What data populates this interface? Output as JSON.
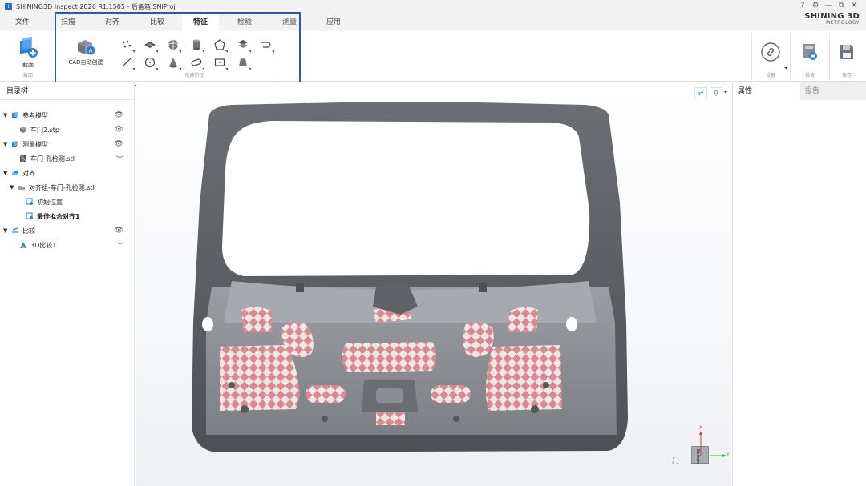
{
  "window": {
    "title": "SHINING3D Inspect 2026 R1.1505 - 后备箱.SNIProj",
    "app_icon": "I",
    "controls": [
      "?",
      "⚙",
      "—",
      "⧉",
      "✕"
    ]
  },
  "brand": {
    "line1": "SHINING 3D",
    "line2": "METROLOGY"
  },
  "ribbon": {
    "tabs": [
      {
        "label": "文件"
      },
      {
        "label": "扫描"
      },
      {
        "label": "对齐"
      },
      {
        "label": "比较"
      },
      {
        "label": "特征",
        "active": true
      },
      {
        "label": "检验"
      },
      {
        "label": "测量"
      },
      {
        "label": "应用"
      }
    ],
    "section_button": {
      "label": "截面",
      "group": "截面"
    },
    "cad_button": {
      "label": "CAD自动创建"
    },
    "create_feature_group": "创建特征",
    "tools_row1": [
      "points-icon",
      "plane-icon",
      "sphere-icon",
      "cylinder-icon",
      "polygon-icon",
      "layers-icon",
      "slot-curve-icon"
    ],
    "tools_row2": [
      "line-icon",
      "circle-icon",
      "cone-icon",
      "slot-icon",
      "rectangle-icon",
      "truncated-cone-icon"
    ],
    "device_group": "设备",
    "report_group": "报告",
    "save_group": "保存"
  },
  "left_panel": {
    "title": "目录树",
    "items": [
      {
        "label": "参考模型",
        "level": 0,
        "expanded": true,
        "visible": "eye"
      },
      {
        "label": "车门2.stp",
        "level": 1,
        "visible": "eye"
      },
      {
        "label": "测量模型",
        "level": 0,
        "expanded": true,
        "visible": "eye"
      },
      {
        "label": "车门-孔检测.stl",
        "level": 1,
        "visible": "closed"
      },
      {
        "label": "对齐",
        "level": 0,
        "expanded": true
      },
      {
        "label": "对齐组-车门-孔检测.stl",
        "level": 1,
        "expanded": true
      },
      {
        "label": "初始位置",
        "level": 2
      },
      {
        "label": "最佳拟合对齐1",
        "level": 2,
        "bold": true
      },
      {
        "label": "比较",
        "level": 0,
        "expanded": true,
        "visible": "eye"
      },
      {
        "label": "3D比较1",
        "level": 1,
        "visible": "closed"
      }
    ]
  },
  "right_panel": {
    "tabs": [
      "属性",
      "报告"
    ]
  },
  "viewport": {
    "axes": {
      "x": "X",
      "y": "Y",
      "cube": "Bottom"
    }
  },
  "colors": {
    "accent": "#2356c9",
    "tab_bg": "#f3f3f3",
    "checker_red": "#d9898d"
  }
}
